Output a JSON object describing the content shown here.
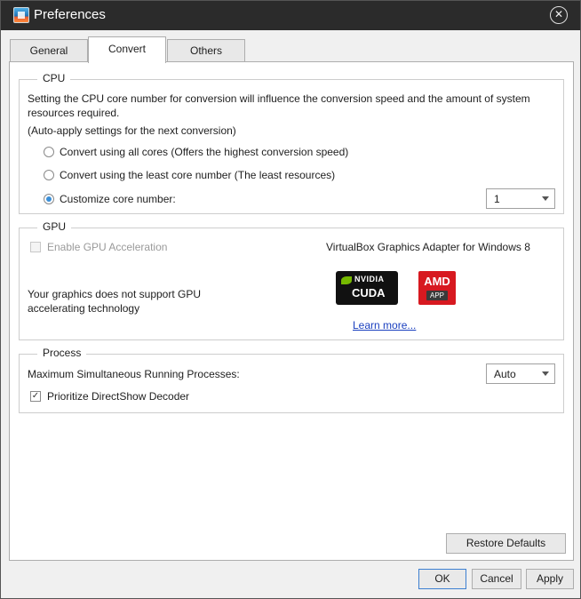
{
  "window": {
    "title": "Preferences"
  },
  "tabs": [
    {
      "label": "General",
      "active": false
    },
    {
      "label": "Convert",
      "active": true
    },
    {
      "label": "Others",
      "active": false
    }
  ],
  "cpu": {
    "label": "CPU",
    "description": "Setting the CPU core number for conversion will influence the conversion speed and the amount of system resources required.",
    "auto_apply": "(Auto-apply settings for the next conversion)",
    "options": [
      {
        "label": "Convert using all cores (Offers the highest conversion speed)",
        "checked": false
      },
      {
        "label": "Convert using the least core number (The least resources)",
        "checked": false
      },
      {
        "label": "Customize core number:",
        "checked": true
      }
    ],
    "core_number": "1"
  },
  "gpu": {
    "label": "GPU",
    "enable_label": "Enable GPU Acceleration",
    "enabled": false,
    "adapter": "VirtualBox Graphics Adapter for Windows 8",
    "unsupported_message": "Your graphics does not support GPU accelerating technology",
    "nvidia_brand": "NVIDIA",
    "nvidia_product": "CUDA",
    "amd_brand": "AMD",
    "amd_product": "APP",
    "learn_more": "Learn more..."
  },
  "process": {
    "label": "Process",
    "max_processes_label": "Maximum Simultaneous Running Processes:",
    "max_processes_value": "Auto",
    "directshow_label": "Prioritize DirectShow Decoder",
    "directshow_checked": true
  },
  "buttons": {
    "restore_defaults": "Restore Defaults",
    "ok": "OK",
    "cancel": "Cancel",
    "apply": "Apply"
  },
  "colors": {
    "titlebar": "#2b2b2b",
    "accent": "#3a8fd8",
    "link": "#1a3fbf",
    "nvidia_green": "#76b900",
    "amd_red": "#d71920"
  }
}
